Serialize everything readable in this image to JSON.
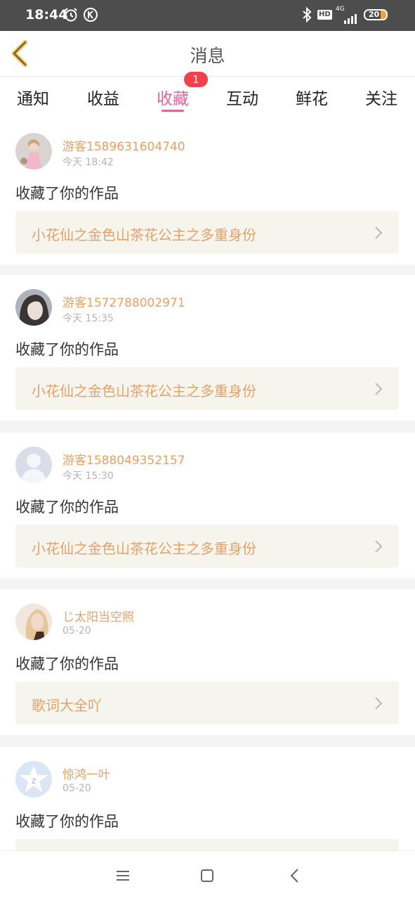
{
  "status_bar": {
    "time": "18:44",
    "battery": "20",
    "network": "4G",
    "hd": "HD",
    "icons": [
      "alarm-icon",
      "k-app-icon",
      "bluetooth-icon",
      "hd-icon",
      "signal-icon",
      "battery-icon"
    ]
  },
  "header": {
    "title": "消息",
    "back_icon": "chevron-left-icon"
  },
  "tabs": {
    "items": [
      {
        "label": "通知"
      },
      {
        "label": "收益"
      },
      {
        "label": "收藏"
      },
      {
        "label": "互动"
      },
      {
        "label": "鲜花"
      },
      {
        "label": "关注"
      }
    ],
    "active": "收藏",
    "badge": "1"
  },
  "messages": [
    {
      "user": "游客1589631604740",
      "time": "今天 18:42",
      "action": "收藏了你的作品",
      "work": "小花仙之金色山茶花公主之多重身份"
    },
    {
      "user": "游客1572788002971",
      "time": "今天 15:35",
      "action": "收藏了你的作品",
      "work": "小花仙之金色山茶花公主之多重身份"
    },
    {
      "user": "游客1588049352157",
      "time": "今天 15:30",
      "action": "收藏了你的作品",
      "work": "小花仙之金色山茶花公主之多重身份"
    },
    {
      "user": "じ太阳当空照",
      "time": "05-20",
      "action": "收藏了你的作品",
      "work": "歌词大全吖"
    },
    {
      "user": "惊鸿一叶",
      "time": "05-20",
      "action": "收藏了你的作品",
      "work": ""
    }
  ],
  "colors": {
    "accent_pink": "#e0669b",
    "username_orange": "#e4a16a",
    "badge_red": "#f2414a",
    "work_box_bg": "#f5f5ee"
  }
}
